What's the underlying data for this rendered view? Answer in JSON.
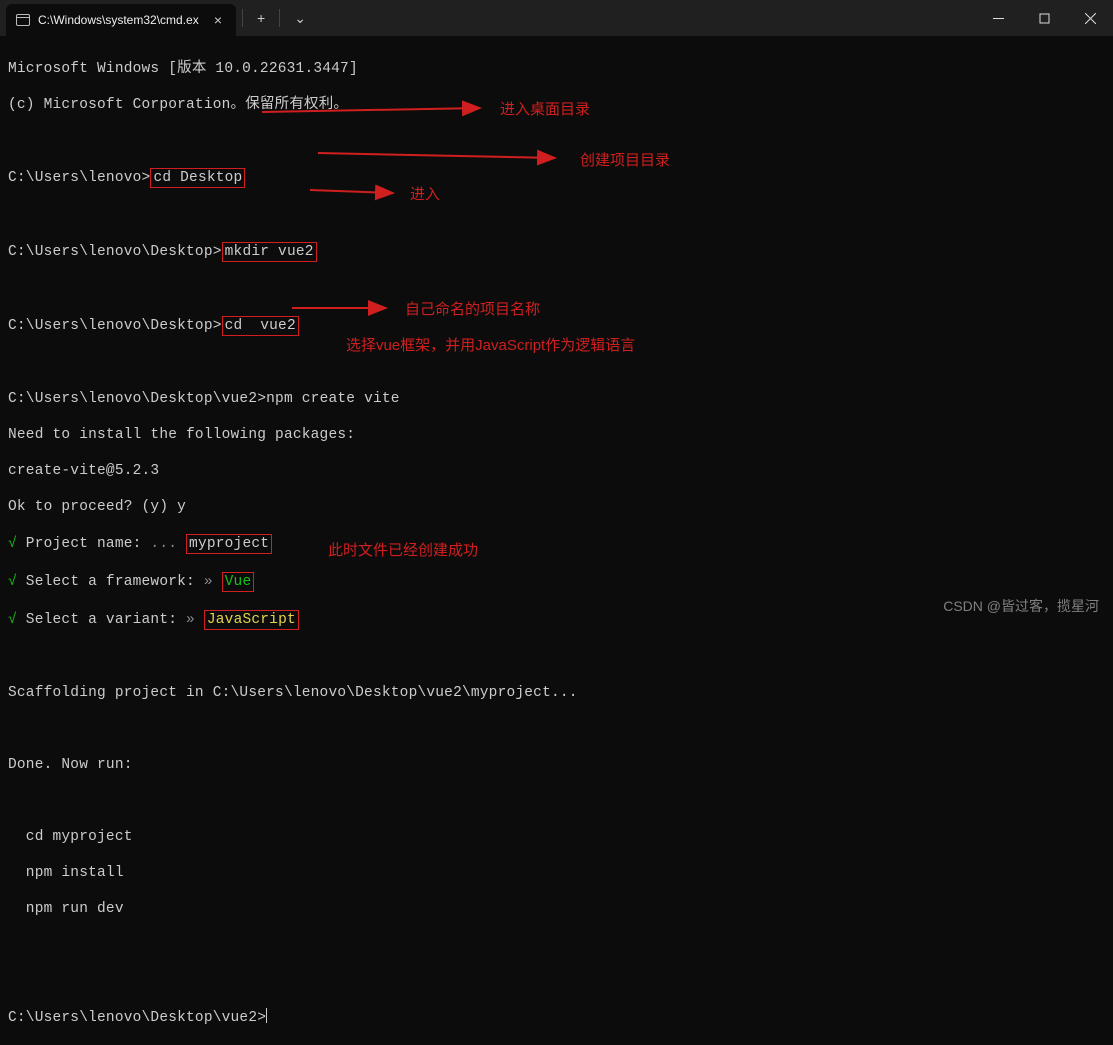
{
  "titlebar": {
    "tab_title": "C:\\Windows\\system32\\cmd.ex",
    "close_glyph": "×",
    "newtab_glyph": "+",
    "dropdown_glyph": "⌄",
    "min_glyph": "—",
    "max_glyph": "▢",
    "x_glyph": "✕"
  },
  "lines": {
    "l1": "Microsoft Windows [版本 10.0.22631.3447]",
    "l2": "(c) Microsoft Corporation。保留所有权利。",
    "p1": "C:\\Users\\lenovo>",
    "cmd_cd_desktop": "cd Desktop",
    "p2": "C:\\Users\\lenovo\\Desktop>",
    "cmd_mkdir": "mkdir vue2",
    "cmd_cd_vue2": "cd  vue2",
    "p3": "C:\\Users\\lenovo\\Desktop\\vue2>",
    "cmd_npm": "npm create vite",
    "need": "Need to install the following packages:",
    "pkg": "create-vite@5.2.3",
    "ok": "Ok to proceed? (y) y",
    "proj_label": " Project name:",
    "dots": " ... ",
    "proj_name": "myproject",
    "fw_prefix": " Select a framework:",
    "arrow": " » ",
    "fw_val": "Vue",
    "var_prefix": " Select a variant:",
    "var_val": "JavaScript",
    "scaff": "Scaffolding project in C:\\Users\\lenovo\\Desktop\\vue2\\myproject...",
    "done": "Done. Now run:",
    "r1": "  cd myproject",
    "r2": "  npm install",
    "r3": "  npm run dev",
    "final_prompt": "C:\\Users\\lenovo\\Desktop\\vue2>",
    "check": "√"
  },
  "annotations": {
    "a1": "进入桌面目录",
    "a2": "创建项目目录",
    "a3": "进入",
    "a4": "自己命名的项目名称",
    "a5": "选择vue框架，并用JavaScript作为逻辑语言",
    "a6": "此时文件已经创建成功"
  },
  "watermark": "CSDN @皆过客，揽星河"
}
